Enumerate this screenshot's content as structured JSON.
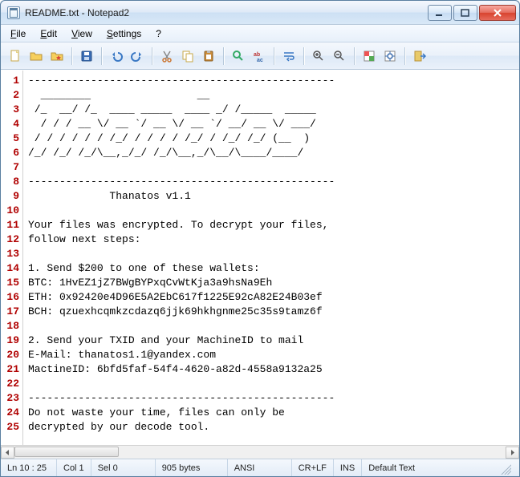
{
  "window": {
    "title": "README.txt - Notepad2"
  },
  "menu": {
    "file": "File",
    "edit": "Edit",
    "view": "View",
    "settings": "Settings",
    "help": "?"
  },
  "toolbar_icons": {
    "new": "new-file-icon",
    "open": "open-folder-icon",
    "browse": "folder-favorite-icon",
    "save": "save-icon",
    "undo": "undo-icon",
    "redo": "redo-icon",
    "cut": "cut-icon",
    "copy": "copy-icon",
    "paste": "paste-icon",
    "find": "find-icon",
    "replace": "replace-icon",
    "wordwrap": "word-wrap-icon",
    "zoomin": "zoom-in-icon",
    "zoomout": "zoom-out-icon",
    "scheme": "scheme-icon",
    "config": "config-icon",
    "exit": "exit-icon"
  },
  "content": {
    "lines": [
      "-------------------------------------------------",
      "  ________                 __",
      " /_  __/ /_  ____ _____  ____ _/ /_____  _____",
      "  / / / __ \\/ __ `/ __ \\/ __ `/ __/ __ \\/ ___/",
      " / / / / / / /_/ / / / / /_/ / /_/ /_/ (__  )",
      "/_/ /_/ /_/\\__,_/_/ /_/\\__,_/\\__/\\____/____/",
      "",
      "-------------------------------------------------",
      "             Thanatos v1.1",
      "",
      "Your files was encrypted. To decrypt your files,",
      "follow next steps:",
      "",
      "1. Send $200 to one of these wallets:",
      "BTC: 1HvEZ1jZ7BWgBYPxqCvWtKja3a9hsNa9Eh",
      "ETH: 0x92420e4D96E5A2EbC617f1225E92cA82E24B03ef",
      "BCH: qzuexhcqmkzcdazq6jjk69hkhgnme25c35s9tamz6f",
      "",
      "2. Send your TXID and your MachineID to mail",
      "E-Mail: thanatos1.1@yandex.com",
      "MactineID: 6bfd5faf-54f4-4620-a82d-4558a9132a25",
      "",
      "-------------------------------------------------",
      "Do not waste your time, files can only be",
      "decrypted by our decode tool."
    ]
  },
  "status": {
    "pos": "Ln 10 : 25",
    "col": "Col 1",
    "sel": "Sel 0",
    "size": "905 bytes",
    "encoding": "ANSI",
    "eol": "CR+LF",
    "mode": "INS",
    "scheme": "Default Text"
  }
}
